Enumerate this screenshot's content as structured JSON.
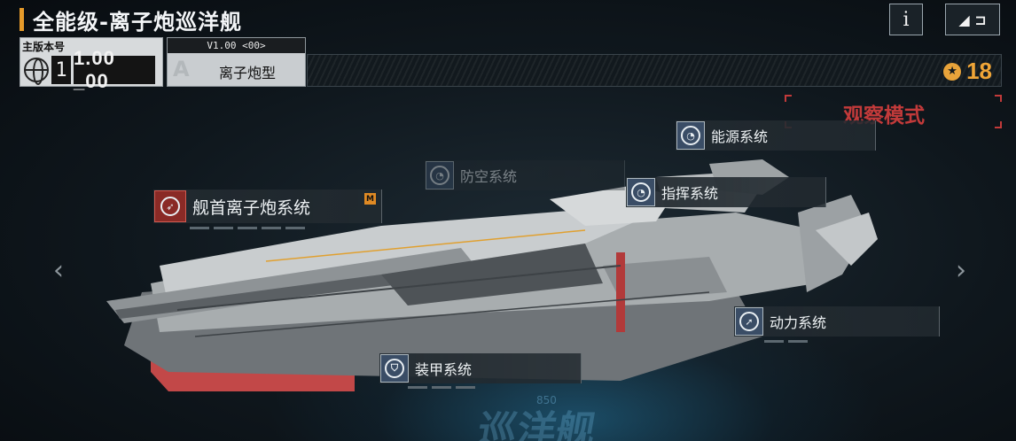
{
  "header": {
    "title": "全能级-离子炮巡洋舰",
    "info_label": "i",
    "back_label": "◢ ⊐"
  },
  "version": {
    "label": "主版本号",
    "major": "1",
    "minor": "1.00 _00"
  },
  "variant": {
    "version_tag": "V1.00 <00>",
    "letter": "A",
    "name": "离子炮型"
  },
  "stars": {
    "count": "18",
    "icon": "star-badge-icon"
  },
  "observe_mode": "观察模式",
  "floor": {
    "mark": "巡洋舰",
    "number": "850"
  },
  "systems": {
    "energy": "能源系统",
    "antiair": "防空系统",
    "bow_ion": "舰首离子炮系统",
    "command": "指挥系统",
    "power": "动力系统",
    "armor": "装甲系统",
    "bow_tag": "M"
  },
  "colors": {
    "accent_orange": "#e49a2a",
    "observe_red": "#c23a3a",
    "star_gold": "#f0a537"
  }
}
